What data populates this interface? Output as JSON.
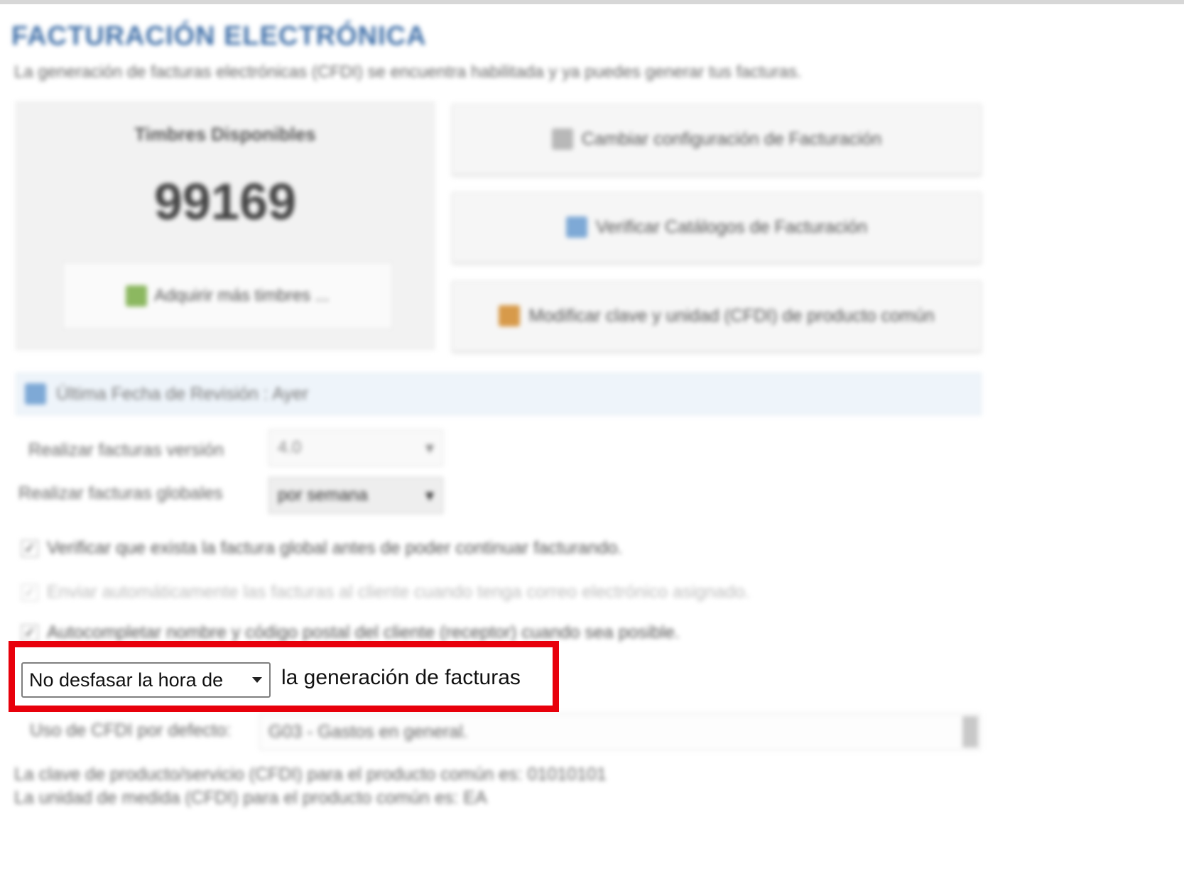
{
  "header": {
    "title": "FACTURACIÓN ELECTRÓNICA",
    "subtitle": "La generación de facturas electrónicas (CFDI) se encuentra habilitada y ya puedes generar tus facturas."
  },
  "stamps": {
    "label": "Timbres Disponibles",
    "value": "99169",
    "buy_button_label": "Adquirir más timbres ..."
  },
  "actions": {
    "change_config_label": "Cambiar configuración de Facturación",
    "verify_catalogs_label": "Verificar Catálogos de Facturación",
    "modify_key_label": "Modificar clave y unidad (CFDI) de producto común"
  },
  "revision": {
    "text": "Última Fecha de Revisión : Ayer"
  },
  "settings": {
    "version_label": "Realizar facturas versión",
    "version_value": "4.0",
    "global_label": "Realizar facturas globales",
    "global_value": "por semana",
    "verify_global_check": "Verificar que exista la factura global antes de poder continuar facturando.",
    "verify_global_checked": true,
    "send_auto_check": "Enviar automáticamente las facturas al cliente cuando tenga correo electrónico asignado.",
    "send_auto_checked": true,
    "autocomplete_check": "Autocompletar nombre y código postal del cliente (receptor) cuando sea posible.",
    "autocomplete_checked": true,
    "shift_select_value": "No desfasar la hora de",
    "shift_text": "la generación de facturas",
    "cfdi_use_label": "Uso de CFDI por defecto:",
    "cfdi_use_value": "G03 - Gastos en general."
  },
  "footnotes": {
    "product_key": "La clave de producto/servicio (CFDI) para el producto común es: 01010101",
    "unit_key": "La unidad de medida (CFDI) para el producto común es: EA"
  },
  "colors": {
    "highlight": "#e8000b",
    "title": "#3f6fa8"
  }
}
